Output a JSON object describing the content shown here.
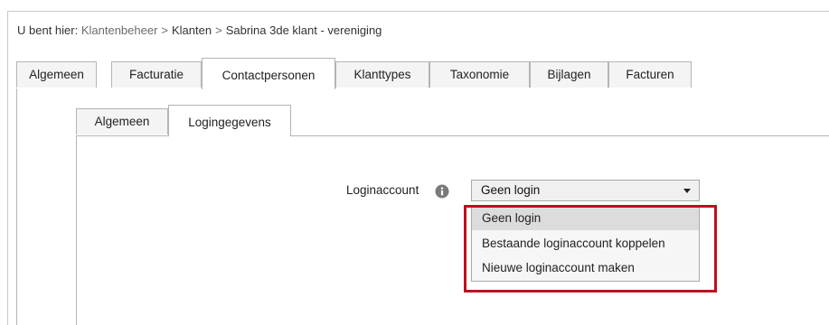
{
  "breadcrumb": {
    "prefix": "U bent hier:",
    "items": [
      "Klantenbeheer",
      "Klanten",
      "Sabrina 3de klant - vereniging"
    ],
    "separator": ">"
  },
  "tabs_top": [
    {
      "label": "Algemeen",
      "active": false
    },
    {
      "label": "Facturatie",
      "active": false
    },
    {
      "label": "Contactpersonen",
      "active": true
    },
    {
      "label": "Klanttypes",
      "active": false
    },
    {
      "label": "Taxonomie",
      "active": false
    },
    {
      "label": "Bijlagen",
      "active": false
    },
    {
      "label": "Facturen",
      "active": false
    }
  ],
  "tabs_inner": [
    {
      "label": "Algemeen",
      "active": false
    },
    {
      "label": "Logingegevens",
      "active": true
    }
  ],
  "login_field": {
    "label": "Loginaccount",
    "info_icon": "info-circle-icon",
    "selected": "Geen login",
    "options": [
      "Geen login",
      "Bestaande loginaccount koppelen",
      "Nieuwe loginaccount maken"
    ]
  },
  "colors": {
    "highlight": "#c00d1e",
    "tab_border": "#b4b4b4",
    "option_selected_bg": "#dcdcdc"
  }
}
